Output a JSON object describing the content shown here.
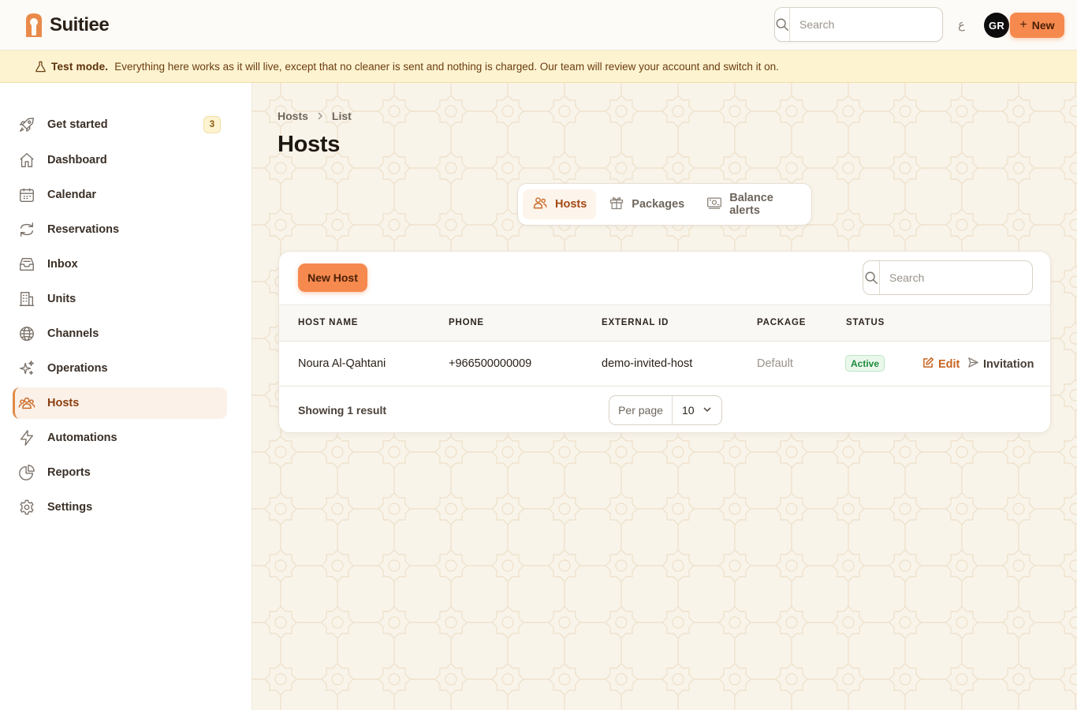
{
  "app": {
    "name": "Suitiee"
  },
  "topbar": {
    "search_placeholder": "Search",
    "lang_toggle": "ع",
    "avatar_initials": "GR",
    "new_label": "New",
    "new_icon": "plus-icon"
  },
  "banner": {
    "title": "Test mode.",
    "message": "Everything here works as it will live, except that no cleaner is sent and nothing is charged. Our team will review your account and switch it on.",
    "icon": "flask-icon"
  },
  "sidebar": {
    "items": [
      {
        "label": "Get started",
        "icon": "rocket-icon",
        "badge": "3"
      },
      {
        "label": "Dashboard",
        "icon": "home-icon"
      },
      {
        "label": "Calendar",
        "icon": "calendar-icon"
      },
      {
        "label": "Reservations",
        "icon": "arrows-cycle-icon"
      },
      {
        "label": "Inbox",
        "icon": "inbox-icon"
      },
      {
        "label": "Units",
        "icon": "building-icon"
      },
      {
        "label": "Channels",
        "icon": "globe-icon"
      },
      {
        "label": "Operations",
        "icon": "sparkles-icon"
      },
      {
        "label": "Hosts",
        "icon": "users-icon",
        "active": true
      },
      {
        "label": "Automations",
        "icon": "bolt-icon"
      },
      {
        "label": "Reports",
        "icon": "pie-chart-icon"
      },
      {
        "label": "Settings",
        "icon": "gear-icon"
      }
    ]
  },
  "breadcrumb": {
    "items": [
      "Hosts",
      "List"
    ]
  },
  "page": {
    "title": "Hosts"
  },
  "tabs": [
    {
      "label": "Hosts",
      "icon": "users-icon",
      "active": true
    },
    {
      "label": "Packages",
      "icon": "gift-icon"
    },
    {
      "label": "Balance alerts",
      "icon": "money-icon"
    }
  ],
  "table": {
    "new_button": "New Host",
    "search_placeholder": "Search",
    "columns": [
      "HOST NAME",
      "PHONE",
      "EXTERNAL ID",
      "PACKAGE",
      "STATUS"
    ],
    "rows": [
      {
        "host_name": "Noura Al-Qahtani",
        "phone": "+966500000009",
        "external_id": "demo-invited-host",
        "package": "Default",
        "status": "Active",
        "actions": {
          "edit": "Edit",
          "invitation": "Invitation"
        }
      }
    ],
    "footer": {
      "result_text": "Showing 1 result",
      "per_page_label": "Per page",
      "per_page_value": "10"
    }
  },
  "colors": {
    "accent": "#f5894e",
    "accent_text": "#c8641f",
    "banner_bg": "#fdf3d0",
    "active_status": "#1f8a3b",
    "page_bg": "#f9f4ea"
  }
}
